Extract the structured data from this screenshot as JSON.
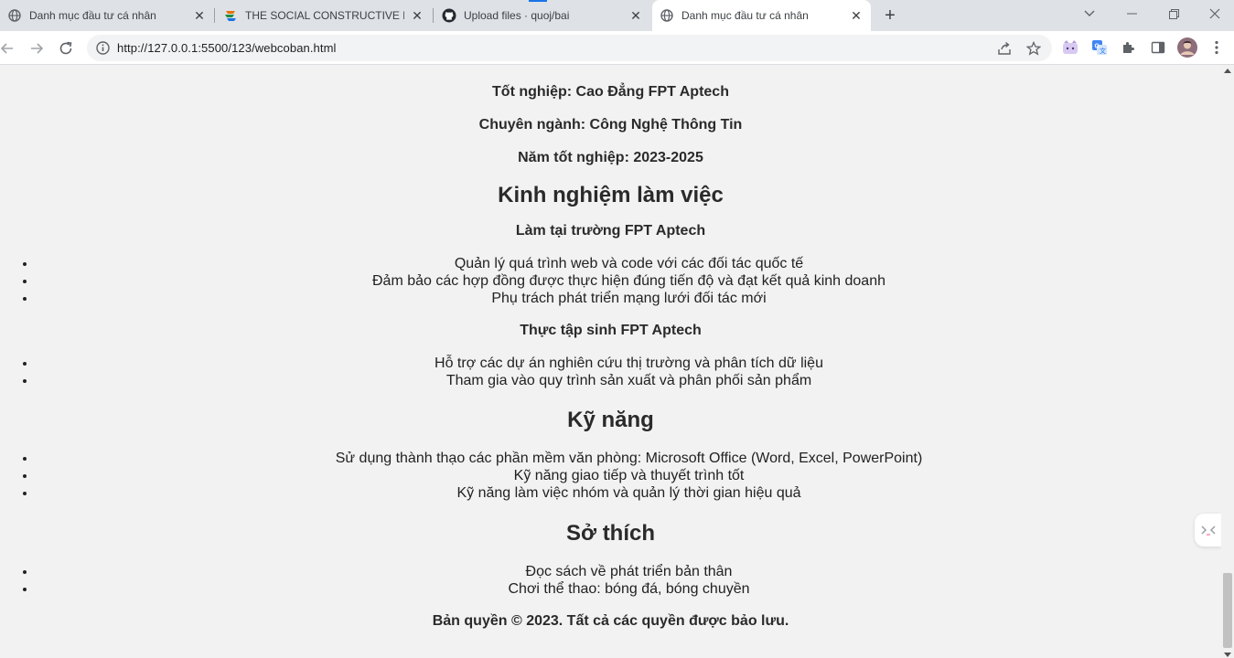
{
  "browser": {
    "tabs": [
      {
        "title": "Danh mục đầu tư cá nhân",
        "icon": "globe-icon",
        "active": false
      },
      {
        "title": "THE SOCIAL CONSTRUCTIVE LEA",
        "icon": "site-logo-icon",
        "active": false
      },
      {
        "title": "Upload files · quoj/bai",
        "icon": "github-icon",
        "active": false
      },
      {
        "title": "Danh mục đầu tư cá nhân",
        "icon": "globe-icon",
        "active": true
      }
    ],
    "address_url": "http://127.0.0.1:5500/123/webcoban.html"
  },
  "education": {
    "graduation": "Tốt nghiệp: Cao Đẳng FPT Aptech",
    "major": "Chuyên ngành: Công Nghệ Thông Tin",
    "years": "Năm tốt nghiệp: 2023-2025"
  },
  "experience": {
    "heading": "Kinh nghiệm làm việc",
    "jobs": [
      {
        "title": "Làm tại trường FPT Aptech",
        "duties": [
          "Quản lý quá trình web và code với các đối tác quốc tế",
          "Đảm bảo các hợp đồng được thực hiện đúng tiến độ và đạt kết quả kinh doanh",
          "Phụ trách phát triển mạng lưới đối tác mới"
        ]
      },
      {
        "title": "Thực tập sinh FPT Aptech",
        "duties": [
          "Hỗ trợ các dự án nghiên cứu thị trường và phân tích dữ liệu",
          "Tham gia vào quy trình sản xuất và phân phối sản phẩm"
        ]
      }
    ]
  },
  "skills": {
    "heading": "Kỹ năng",
    "items": [
      "Sử dụng thành thạo các phần mềm văn phòng: Microsoft Office (Word, Excel, PowerPoint)",
      "Kỹ năng giao tiếp và thuyết trình tốt",
      "Kỹ năng làm việc nhóm và quản lý thời gian hiệu quả"
    ]
  },
  "hobbies": {
    "heading": "Sở thích",
    "items": [
      "Đọc sách về phát triển bản thân",
      "Chơi thể thao: bóng đá, bóng chuyền"
    ]
  },
  "footer": {
    "copyright": "Bản quyền © 2023. Tất cả các quyền được bảo lưu."
  },
  "colors": {
    "page_background": "#f2f2f2",
    "text": "#222222",
    "tabstrip": "#dee1e6",
    "accent": "#1a73e8"
  }
}
